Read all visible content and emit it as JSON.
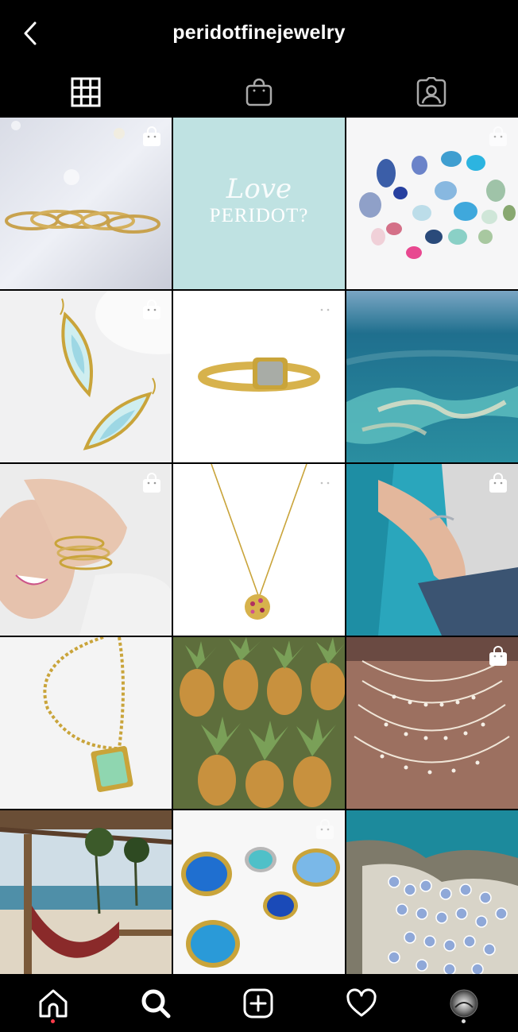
{
  "header": {
    "title": "peridotfinejewelry",
    "back_icon": "chevron-left-icon"
  },
  "tabs": [
    {
      "name": "grid",
      "icon": "grid-icon",
      "active": true
    },
    {
      "name": "shop",
      "icon": "shopping-bag-icon",
      "active": false
    },
    {
      "name": "tagged",
      "icon": "tagged-user-icon",
      "active": false
    }
  ],
  "grid": {
    "promo_tile": {
      "script_text": "Love",
      "main_text": "PERIDOT?",
      "bg_color": "#bfe2e2"
    }
  },
  "bottom_nav": [
    {
      "name": "home",
      "icon": "home-icon",
      "notification_dot": true
    },
    {
      "name": "search",
      "icon": "search-icon",
      "active": true
    },
    {
      "name": "new-post",
      "icon": "plus-square-icon"
    },
    {
      "name": "activity",
      "icon": "heart-icon"
    },
    {
      "name": "profile",
      "icon": "profile-avatar-icon"
    }
  ],
  "colors": {
    "background": "#000000",
    "notification": "#ff3b4a",
    "accent_teal": "#bfe2e2"
  }
}
